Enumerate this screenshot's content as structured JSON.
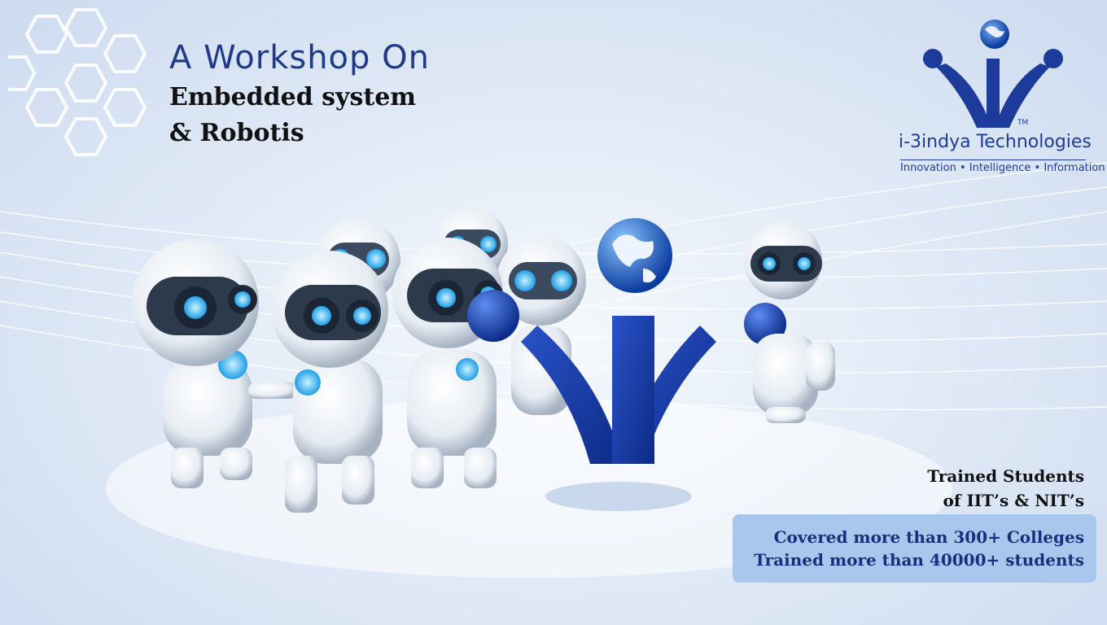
{
  "header": {
    "line1": "A Workshop On",
    "line2": "Embedded system",
    "line3": "& Robotis"
  },
  "logo": {
    "name": "i-3indya Technologies",
    "tm": "TM",
    "tagline": "Innovation • Intelligence • Information",
    "icon": "globe-person-icon"
  },
  "trained": {
    "line1": "Trained Students",
    "line2": "of IIT’s & NIT’s"
  },
  "stats": {
    "line1": "Covered more than 300+ Colleges",
    "line2": "Trained more than 40000+ students"
  },
  "colors": {
    "brand_blue": "#1d3b9b",
    "title_blue": "#1f3a8a",
    "box_bg": "#a9c7ec",
    "robot_glow": "#3fb7f0"
  }
}
